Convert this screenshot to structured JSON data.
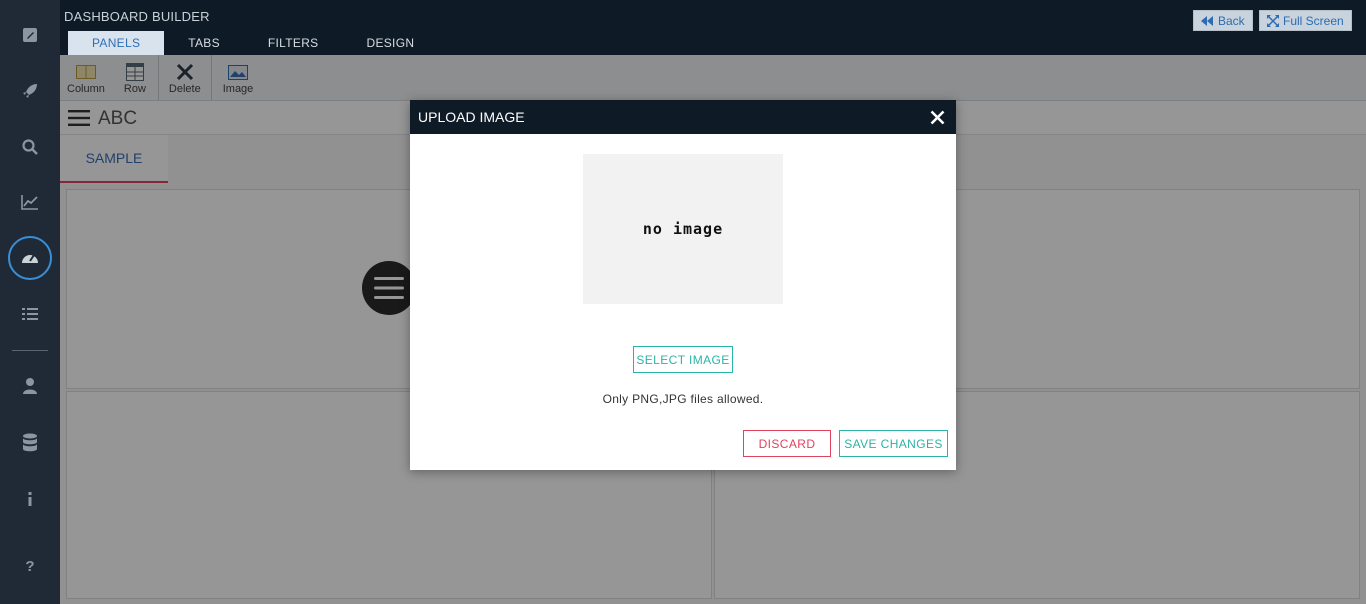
{
  "app": {
    "title": "DASHBOARD BUILDER"
  },
  "nav_tabs": [
    {
      "label": "PANELS"
    },
    {
      "label": "TABS"
    },
    {
      "label": "FILTERS"
    },
    {
      "label": "DESIGN"
    }
  ],
  "top_buttons": {
    "back": "Back",
    "fullscreen": "Full Screen"
  },
  "toolbar": {
    "column": "Column",
    "row": "Row",
    "delete": "Delete",
    "image": "Image"
  },
  "dashboard": {
    "title": "ABC",
    "tab": "SAMPLE"
  },
  "rail_icons": [
    "edit-icon",
    "rocket-icon",
    "search-icon",
    "chart-line-icon",
    "dashboard-gauge-icon",
    "list-icon",
    "user-icon",
    "database-icon",
    "info-icon",
    "help-icon"
  ],
  "modal": {
    "title": "UPLOAD IMAGE",
    "placeholder": "no image",
    "select_button": "SELECT IMAGE",
    "hint": "Only PNG,JPG files allowed.",
    "discard_button": "DISCARD",
    "save_button": "SAVE CHANGES"
  },
  "colors": {
    "rail_bg": "#1f2a36",
    "topbar_bg": "#0e1a26",
    "accent_blue": "#2f6fb6",
    "teal": "#2bb3a8",
    "pink": "#e0435e"
  }
}
